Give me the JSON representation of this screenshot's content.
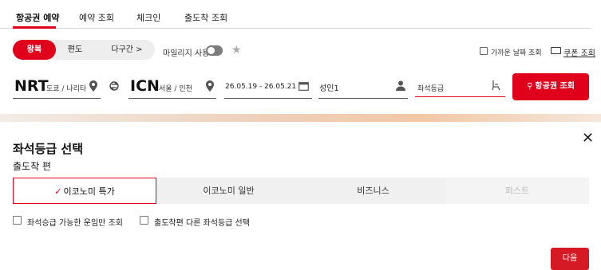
{
  "tabs": [
    {
      "label": "항공권 예약",
      "active": true
    },
    {
      "label": "예약 조회",
      "active": false
    },
    {
      "label": "체크인",
      "active": false
    },
    {
      "label": "출도착 조회",
      "active": false
    }
  ],
  "trip_type": {
    "options": [
      "왕복",
      "편도",
      "다구간 >"
    ],
    "selected": "왕복"
  },
  "mileage": {
    "label": "마일리지 사용",
    "enabled": false
  },
  "nearby_dates": {
    "label": "가까운 날짜 조회",
    "checked": false
  },
  "coupon": {
    "label": "쿠폰 조회"
  },
  "search": {
    "origin_code": "NRT",
    "origin_city": "도쿄 / 나리타",
    "dest_code": "ICN",
    "dest_city": "서울 / 인천",
    "dates": "26.05.19 - 26.05.21",
    "passengers": "성인1",
    "seat_class_placeholder": "좌석등급",
    "button_label": "항공권 조회"
  },
  "seat_panel": {
    "title": "좌석등급 선택",
    "subtitle": "출도착 편",
    "classes": [
      {
        "label": "이코노미 특가",
        "selected": true,
        "disabled": false
      },
      {
        "label": "이코노미 일반",
        "selected": false,
        "disabled": false
      },
      {
        "label": "비즈니스",
        "selected": false,
        "disabled": false
      },
      {
        "label": "퍼스트",
        "selected": false,
        "disabled": true
      }
    ],
    "option_upgrade": "좌석승급 가능한 운임만 조회",
    "option_different": "출도착편 다른 좌석등급 선택",
    "next_label": "다음"
  },
  "colors": {
    "accent": "#e0001b"
  }
}
